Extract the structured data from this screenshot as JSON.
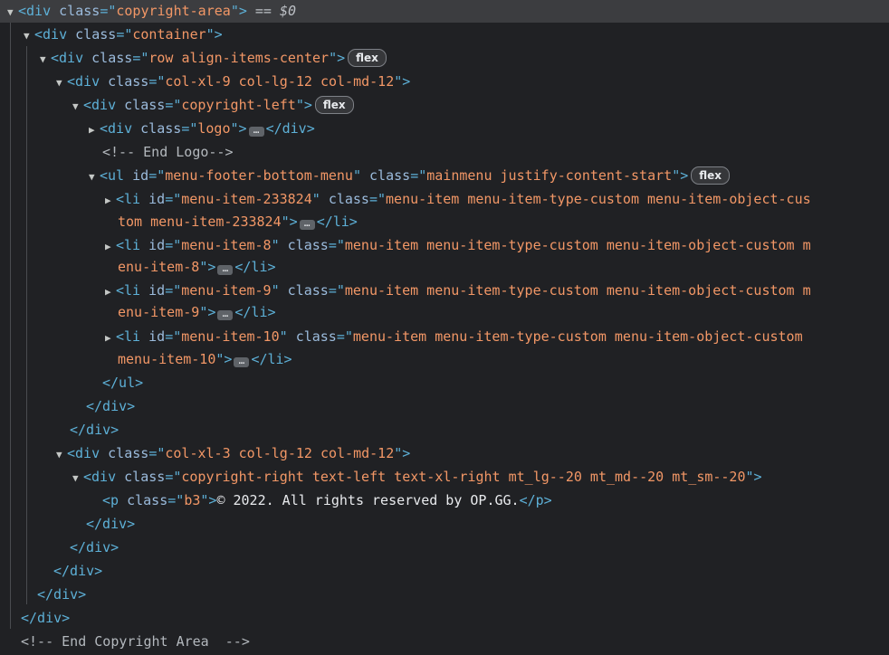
{
  "nodes": {
    "n0": {
      "tag": "div",
      "attr1": "class",
      "val1": "copyright-area",
      "selected_ref": "== $0"
    },
    "n1": {
      "tag": "div",
      "attr1": "class",
      "val1": "container"
    },
    "n2": {
      "tag": "div",
      "attr1": "class",
      "val1": "row align-items-center",
      "badge": "flex"
    },
    "n3": {
      "tag": "div",
      "attr1": "class",
      "val1": "col-xl-9 col-lg-12 col-md-12"
    },
    "n4": {
      "tag": "div",
      "attr1": "class",
      "val1": "copyright-left",
      "badge": "flex"
    },
    "n5": {
      "tag": "div",
      "attr1": "class",
      "val1": "logo",
      "close": "</div>"
    },
    "n6": {
      "comment": "<!-- End Logo-->"
    },
    "n7": {
      "tag": "ul",
      "attr1": "id",
      "val1": "menu-footer-bottom-menu",
      "attr2": "class",
      "val2": "mainmenu justify-content-start",
      "badge": "flex"
    },
    "n8a": {
      "tag": "li",
      "attr1": "id",
      "val1": "menu-item-233824",
      "attr2": "class",
      "val2a": "menu-item menu-item-type-custom menu-item-object-cus"
    },
    "n8b": {
      "val2b": "tom menu-item-233824",
      "close": "</li>"
    },
    "n9a": {
      "tag": "li",
      "attr1": "id",
      "val1": "menu-item-8",
      "attr2": "class",
      "val2a": "menu-item menu-item-type-custom menu-item-object-custom m"
    },
    "n9b": {
      "val2b": "enu-item-8",
      "close": "</li>"
    },
    "n10a": {
      "tag": "li",
      "attr1": "id",
      "val1": "menu-item-9",
      "attr2": "class",
      "val2a": "menu-item menu-item-type-custom menu-item-object-custom m"
    },
    "n10b": {
      "val2b": "enu-item-9",
      "close": "</li>"
    },
    "n11a": {
      "tag": "li",
      "attr1": "id",
      "val1": "menu-item-10",
      "attr2": "class",
      "val2a": "menu-item menu-item-type-custom menu-item-object-custom"
    },
    "n11b": {
      "val2b": "menu-item-10",
      "close": "</li>"
    },
    "n12": {
      "close": "</ul>"
    },
    "n13": {
      "close": "</div>"
    },
    "n14": {
      "close": "</div>"
    },
    "n15": {
      "tag": "div",
      "attr1": "class",
      "val1": "col-xl-3 col-lg-12 col-md-12"
    },
    "n16": {
      "tag": "div",
      "attr1": "class",
      "val1": "copyright-right text-left text-xl-right mt_lg--20 mt_md--20 mt_sm--20"
    },
    "n17": {
      "tag": "p",
      "attr1": "class",
      "val1": "b3",
      "text": "© 2022. All rights reserved by OP.GG.",
      "close": "</p>"
    },
    "n18": {
      "close": "</div>"
    },
    "n19": {
      "close": "</div>"
    },
    "n20": {
      "close": "</div>"
    },
    "n21": {
      "close": "</div>"
    },
    "n22": {
      "close": "</div>"
    },
    "n23": {
      "comment": "<!-- End Copyright Area  -->"
    }
  },
  "icons": {
    "expanded": "▼",
    "collapsed": "▶",
    "ellipsis": "…"
  },
  "colors": {
    "background": "#202124",
    "selected_row": "#3c3d40",
    "tag": "#5db0d7",
    "attribute_name": "#9bbbdc",
    "attribute_value": "#f29766",
    "comment": "#b3b8bd"
  }
}
